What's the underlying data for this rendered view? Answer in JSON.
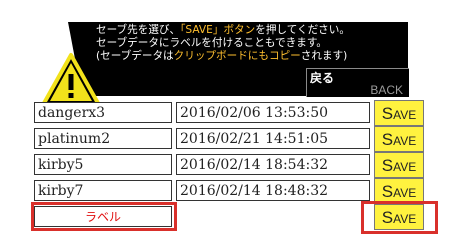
{
  "header": {
    "line1_a": "セーブ先を選び、",
    "line1_hl": "「SAVE」ボタン",
    "line1_b": "を押してください。",
    "line2": "セーブデータにラベルを付けることもできます。",
    "line3_a": "(セーブデータは",
    "line3_hl": "クリップボードにもコピー",
    "line3_b": "されます)",
    "back_label_jp": "戻る",
    "back_label_en": "BACK"
  },
  "slots": [
    {
      "name": "dangerx3",
      "date": "2016/02/06 13:53:50"
    },
    {
      "name": "platinum2",
      "date": "2016/02/21 14:51:05"
    },
    {
      "name": "kirby5",
      "date": "2016/02/14 18:54:32"
    },
    {
      "name": "kirby7",
      "date": "2016/02/14 18:48:32"
    }
  ],
  "new_slot": {
    "label_placeholder": "ラベル",
    "date": ""
  },
  "save_button": {
    "cap": "S",
    "rest": "AVE"
  },
  "colors": {
    "highlight": "#ffbf2e",
    "save_bg": "#fff23f",
    "frame": "#d9302b",
    "label_text": "#e01010"
  }
}
